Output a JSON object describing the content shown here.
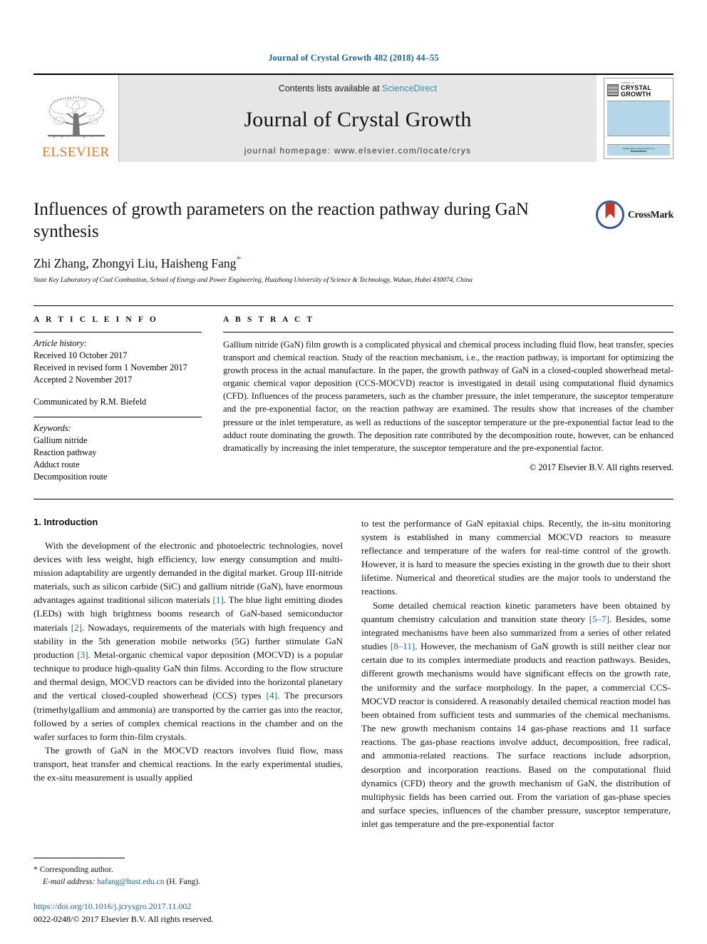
{
  "running_head": "Journal of Crystal Growth 482 (2018) 44–55",
  "masthead": {
    "publisher_name": "ELSEVIER",
    "contents_prefix": "Contents lists available at ",
    "contents_link": "ScienceDirect",
    "journal_title": "Journal of Crystal Growth",
    "homepage": "journal homepage: www.elsevier.com/locate/crys",
    "cover": {
      "sub": "JOURNAL OF",
      "line1": "CRYSTAL",
      "line2": "GROWTH",
      "footer_small": "Available online at www.sciencedirect.com",
      "footer_brand": "ScienceDirect"
    }
  },
  "article": {
    "title": "Influences of growth parameters on the reaction pathway during GaN synthesis",
    "authors": "Zhi Zhang, Zhongyi Liu, Haisheng Fang",
    "corresponding_marker": "*",
    "affiliation": "State Key Laboratory of Coal Combustion, School of Energy and Power Engineering, Huazhong University of Science & Technology, Wuhan, Hubei 430074, China",
    "crossmark_label": "CrossMark"
  },
  "article_info": {
    "heading": "A R T I C L E    I N F O",
    "history_label": "Article history:",
    "history": [
      "Received 10 October 2017",
      "Received in revised form 1 November 2017",
      "Accepted 2 November 2017"
    ],
    "communicated_by": "Communicated by R.M. Biefeld",
    "keywords_label": "Keywords:",
    "keywords": [
      "Gallium nitride",
      "Reaction pathway",
      "Adduct route",
      "Decomposition route"
    ]
  },
  "abstract": {
    "heading": "A B S T R A C T",
    "text": "Gallium nitride (GaN) film growth is a complicated physical and chemical process including fluid flow, heat transfer, species transport and chemical reaction. Study of the reaction mechanism, i.e., the reaction pathway, is important for optimizing the growth process in the actual manufacture. In the paper, the growth pathway of GaN in a closed-coupled showerhead metal-organic chemical vapor deposition (CCS-MOCVD) reactor is investigated in detail using computational fluid dynamics (CFD). Influences of the process parameters, such as the chamber pressure, the inlet temperature, the susceptor temperature and the pre-exponential factor, on the reaction pathway are examined. The results show that increases of the chamber pressure or the inlet temperature, as well as reductions of the susceptor temperature or the pre-exponential factor lead to the adduct route dominating the growth. The deposition rate contributed by the decomposition route, however, can be enhanced dramatically by increasing the inlet temperature, the susceptor temperature and the pre-exponential factor.",
    "copyright": "© 2017 Elsevier B.V. All rights reserved."
  },
  "section": {
    "number_title": "1. Introduction",
    "left_paragraphs": [
      {
        "parts": [
          {
            "t": "With the development of the electronic and photoelectric technologies, novel devices with less weight, high efficiency, low energy consumption and multi-mission adaptability are urgently demanded in the digital market. Group III-nitride materials, such as silicon carbide (SiC) and gallium nitride (GaN), have enormous advantages against traditional silicon materials "
          },
          {
            "t": "[1]",
            "ref": true
          },
          {
            "t": ". The blue light emitting diodes (LEDs) with high brightness booms research of GaN-based semiconductor materials "
          },
          {
            "t": "[2]",
            "ref": true
          },
          {
            "t": ". Nowadays, requirements of the materials with high frequency and stability in the 5th generation mobile networks (5G) further stimulate GaN production "
          },
          {
            "t": "[3]",
            "ref": true
          },
          {
            "t": ". Metal-organic chemical vapor deposition (MOCVD) is a popular technique to produce high-quality GaN thin films. According to the flow structure and thermal design, MOCVD reactors can be divided into the horizontal planetary and the vertical closed-coupled showerhead (CCS) types "
          },
          {
            "t": "[4]",
            "ref": true
          },
          {
            "t": ". The precursors (trimethylgallium and ammonia) are transported by the carrier gas into the reactor, followed by a series of complex chemical reactions in the chamber and on the wafer surfaces to form thin-film crystals."
          }
        ]
      },
      {
        "parts": [
          {
            "t": "The growth of GaN in the MOCVD reactors involves fluid flow, mass transport, heat transfer and chemical reactions. In the early experimental studies, the ex-situ measurement is usually applied"
          }
        ]
      }
    ],
    "right_paragraphs": [
      {
        "continuation": true,
        "parts": [
          {
            "t": "to test the performance of GaN epitaxial chips. Recently, the in-situ monitoring system is established in many commercial MOCVD reactors to measure reflectance and temperature of the wafers for real-time control of the growth. However, it is hard to measure the species existing in the growth due to their short lifetime. Numerical and theoretical studies are the major tools to understand the reactions."
          }
        ]
      },
      {
        "parts": [
          {
            "t": "Some detailed chemical reaction kinetic parameters have been obtained by quantum chemistry calculation and transition state theory "
          },
          {
            "t": "[5–7]",
            "ref": true
          },
          {
            "t": ". Besides, some integrated mechanisms have been also summarized from a series of other related studies "
          },
          {
            "t": "[8–11]",
            "ref": true
          },
          {
            "t": ". However, the mechanism of GaN growth is still neither clear nor certain due to its complex intermediate products and reaction pathways. Besides, different growth mechanisms would have significant effects on the growth rate, the uniformity and the surface morphology. In the paper, a commercial CCS-MOCVD reactor is considered. A reasonably detailed chemical reaction model has been obtained from sufficient tests and summaries of the chemical mechanisms. The new growth mechanism contains 14 gas-phase reactions and 11 surface reactions. The gas-phase reactions involve adduct, decomposition, free radical, and ammonia-related reactions. The surface reactions include adsorption, desorption and incorporation reactions. Based on the computational fluid dynamics (CFD) theory and the growth mechanism of GaN, the distribution of multiphysic fields has been carried out. From the variation of gas-phase species and surface species, influences of the chamber pressure, susceptor temperature, inlet gas temperature and the pre-exponential factor"
          }
        ]
      }
    ]
  },
  "footnote": {
    "star": "*",
    "corresponding": "Corresponding author.",
    "email_label": "E-mail address:",
    "email": "hafang@hust.edu.cn",
    "email_suffix": "(H. Fang).",
    "doi": "https://doi.org/10.1016/j.jcrysgro.2017.11.002",
    "issn_line": "0022-0248/© 2017 Elsevier B.V. All rights reserved."
  },
  "colors": {
    "link": "#1a6496",
    "elsevier_orange": "#E87722",
    "sciencedirect": "#3a8bbb",
    "band_gray": "#e6e6e6",
    "cover_blue": "#b3d7e8"
  }
}
